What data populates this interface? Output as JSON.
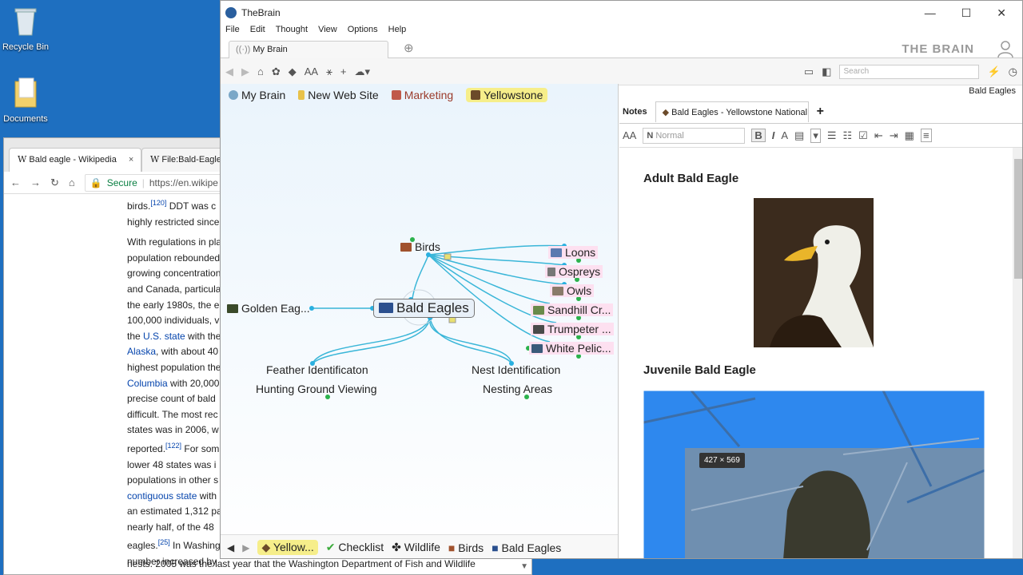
{
  "desktop": {
    "icons": [
      {
        "label": "Recycle Bin",
        "icon": "recycle-bin-icon"
      },
      {
        "label": "Documents",
        "icon": "folder-icon"
      }
    ]
  },
  "browser": {
    "tabs": [
      {
        "label": "Bald eagle - Wikipedia",
        "close": "×"
      },
      {
        "label": "File:Bald-Eagle"
      }
    ],
    "secure": "Secure",
    "url": "https://en.wikipe",
    "paragraph1": [
      "birds.",
      "DDT was c",
      "highly restricted since"
    ],
    "ref120": "[120]",
    "paragraph2": [
      "With regulations in pla",
      "population rebounded",
      "growing concentration",
      "and Canada, particula",
      "the early 1980s, the e",
      "100,000 individuals, v"
    ],
    "the_us": "the ",
    "us_state": "U.S. state",
    "with_the": " with the",
    "alaska": "Alaska",
    "about": ", with about 40",
    "highest": "highest population the",
    "columbia": "Columbia",
    "with20000": " with 20,000",
    "paragraph3": [
      "precise count of bald",
      "difficult. The most rec",
      "states was in 2006, w"
    ],
    "reported": "reported.",
    "ref122": "[122]",
    "for_som": " For som",
    "lower48": "lower 48 states was i",
    "populations": "populations in other s",
    "contiguous": "contiguous state",
    "contiguous_tail": " with",
    "estimated": "an estimated 1,312 pa",
    "nearly": "nearly half, of the 48",
    "eagles": "eagles.",
    "ref25": "[25]",
    "in_wash": " In Washing",
    "number": "number increased by",
    "bottom_line": "nests. 2005 was the last year that the Washington Department of Fish and Wildlife"
  },
  "thebrain": {
    "title": "TheBrain",
    "window_controls": [
      "—",
      "☐",
      "✕"
    ],
    "menu": [
      "File",
      "Edit",
      "Thought",
      "View",
      "Options",
      "Help"
    ],
    "tab": "My Brain",
    "brand": "THE BRAIN",
    "search_placeholder": "Search",
    "pins": [
      {
        "label": "My Brain",
        "color": "#7aa7c7"
      },
      {
        "label": "New Web Site",
        "color": "#e8c24a"
      },
      {
        "label": "Marketing",
        "color": "#c05a4a"
      },
      {
        "label": "Yellowstone",
        "color": "#6b4a2a"
      }
    ],
    "plex": {
      "center": "Bald Eagles",
      "parent": "Birds",
      "jump": "Golden Eag...",
      "siblings": [
        "Loons",
        "Ospreys",
        "Owls",
        "Sandhill Cr...",
        "Trumpeter ...",
        "White Pelic..."
      ],
      "children": [
        "Feather Identificaton",
        "Hunting Ground Viewing",
        "Nest Identification",
        "Nesting Areas"
      ]
    },
    "breadcrumbs": [
      {
        "label": "Yellow...",
        "color": "#6b4a2a"
      },
      {
        "label": "Checklist",
        "color": "#3aaa3a"
      },
      {
        "label": "Wildlife",
        "color": "#333"
      },
      {
        "label": "Birds",
        "color": "#a0522d"
      },
      {
        "label": "Bald Eagles",
        "color": "#2a4f8e"
      }
    ],
    "notes": {
      "thought_name": "Bald Eagles",
      "tab_notes": "Notes",
      "tab_attachment": "Bald Eagles - Yellowstone National...",
      "style_placeholder": "Normal",
      "heading1": "Adult Bald Eagle",
      "heading2": "Juvenile Bald Eagle",
      "size_tooltip": "427 × 569"
    }
  }
}
